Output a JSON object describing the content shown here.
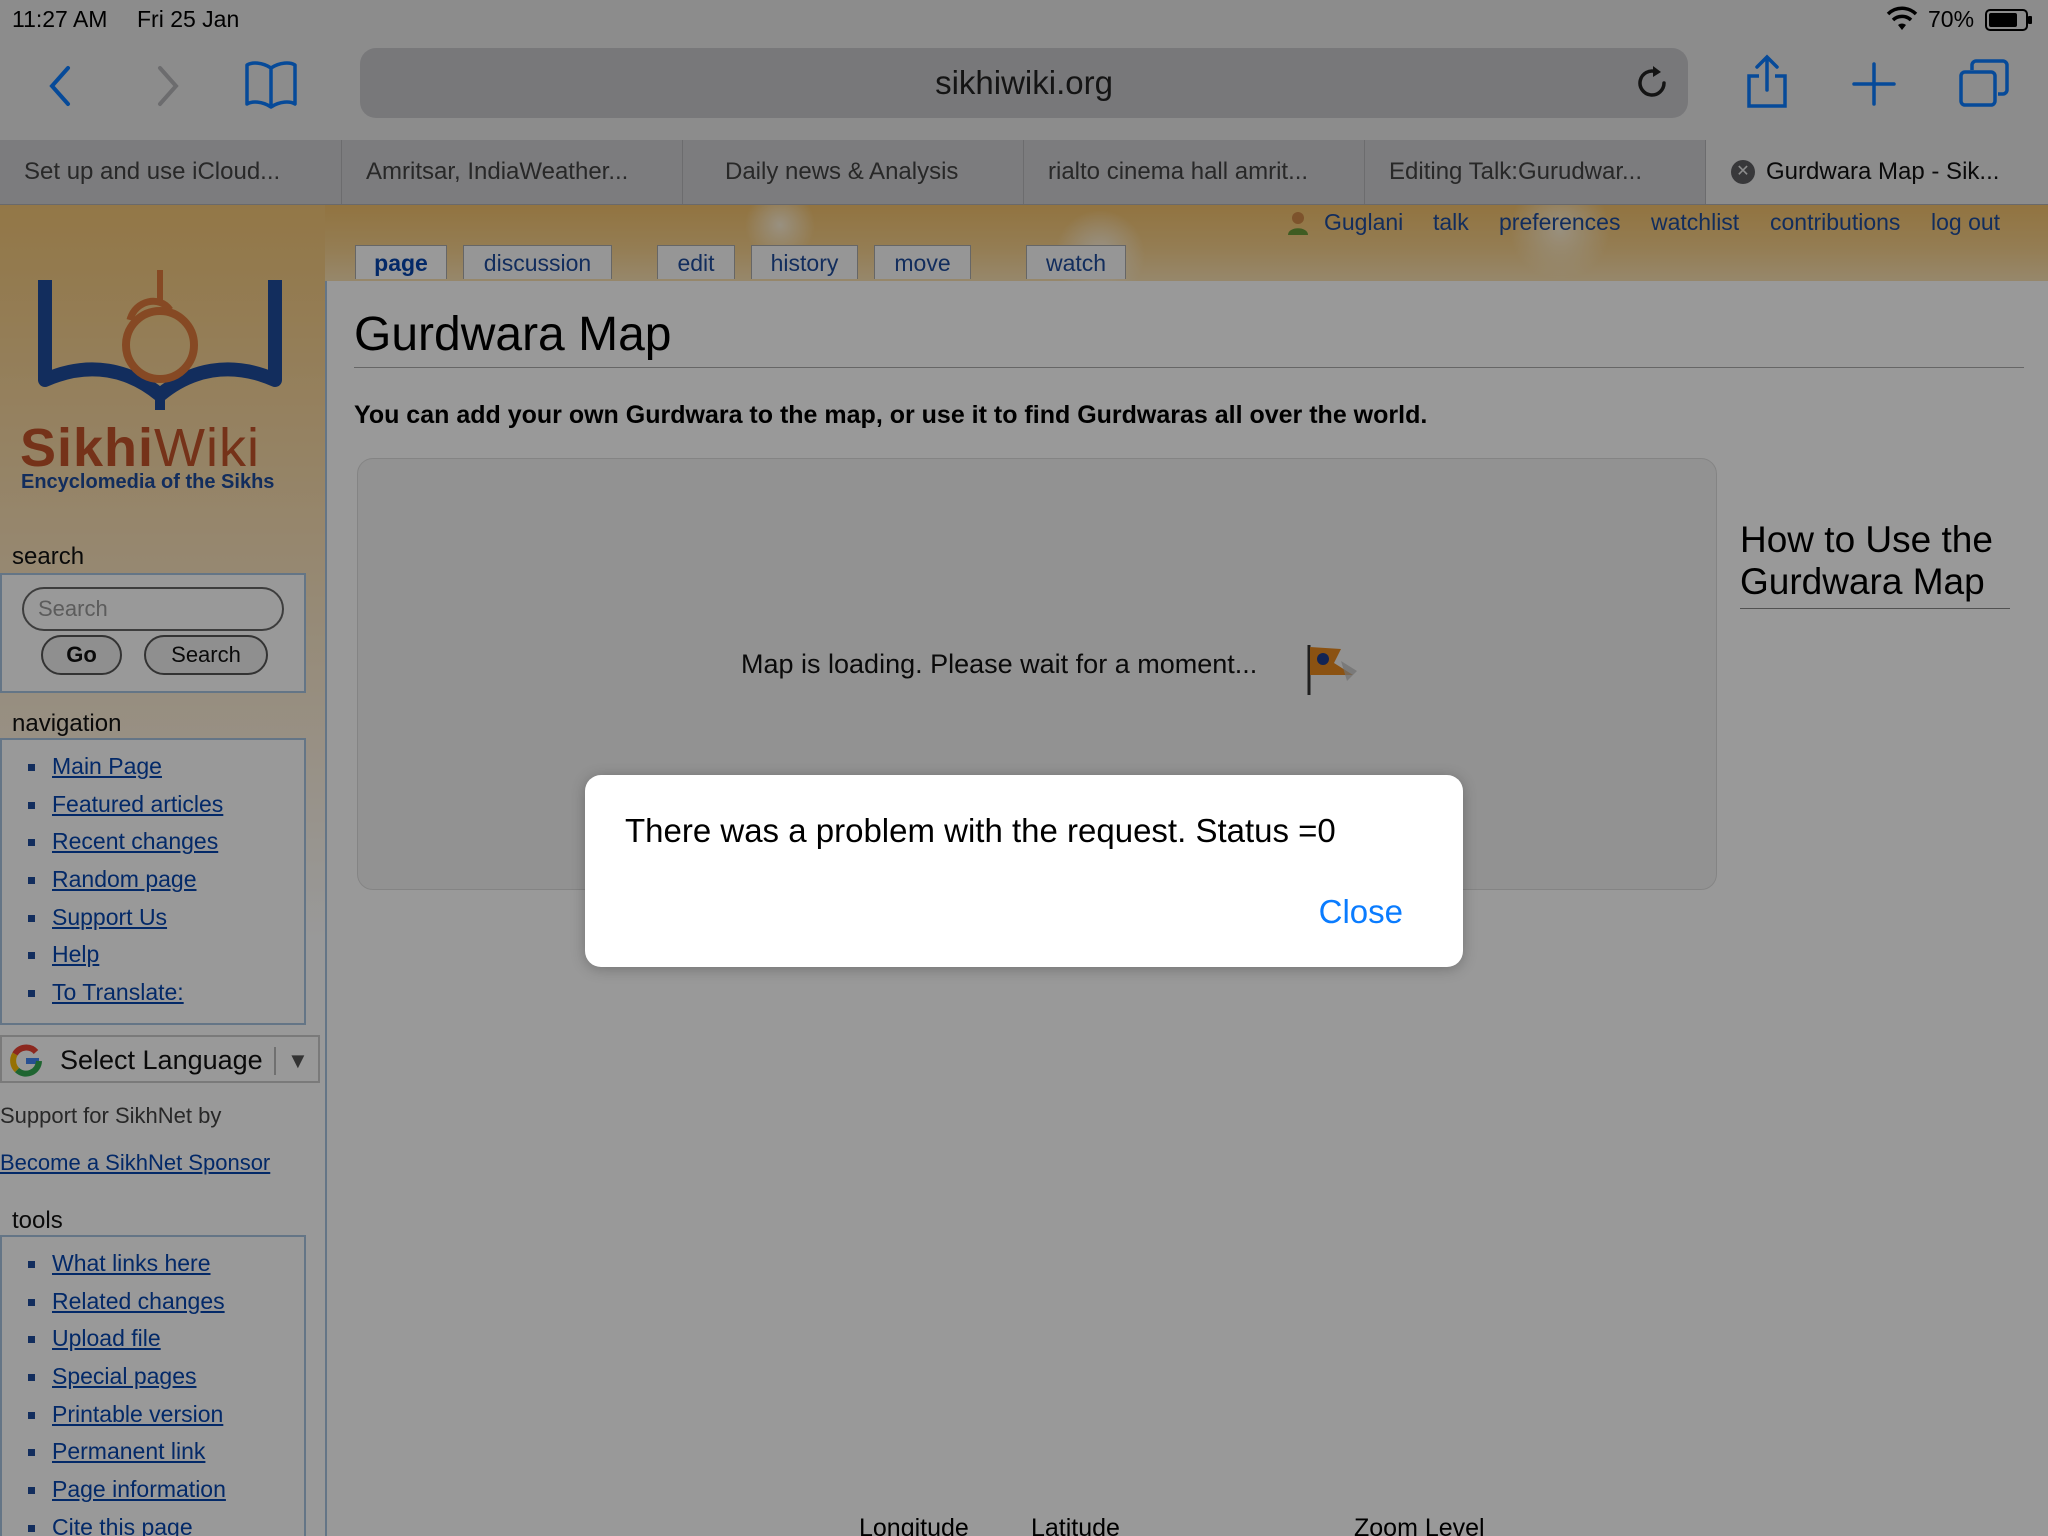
{
  "status_bar": {
    "time": "11:27 AM",
    "date": "Fri 25 Jan",
    "battery": "70%"
  },
  "browser": {
    "url": "sikhiwiki.org",
    "tabs": [
      {
        "label": "Set up and use iCloud..."
      },
      {
        "label": "Amritsar, IndiaWeather..."
      },
      {
        "label": "Daily news & Analysis"
      },
      {
        "label": "rialto cinema hall amrit..."
      },
      {
        "label": "Editing Talk:Gurudwar..."
      },
      {
        "label": "Gurdwara Map - Sik..."
      }
    ]
  },
  "site": {
    "logo_sikhi": "Sikhi",
    "logo_wiki": "Wiki",
    "logo_sub": "Encyclomedia of the Sikhs",
    "user_links": [
      "Guglani",
      "talk",
      "preferences",
      "watchlist",
      "contributions",
      "log out"
    ],
    "page_tabs": [
      "page",
      "discussion",
      "edit",
      "history",
      "move",
      "watch"
    ]
  },
  "sidebar": {
    "search_heading": "search",
    "search_placeholder": "Search",
    "go_label": "Go",
    "search_label": "Search",
    "navigation_heading": "navigation",
    "navigation": [
      "Main Page",
      "Featured articles",
      "Recent changes",
      "Random page",
      "Support Us",
      "Help",
      "To Translate:"
    ],
    "language_label": "Select Language",
    "support_text": "Support for SikhNet by",
    "sponsor_link": "Become a SikhNet Sponsor",
    "tools_heading": "tools",
    "tools": [
      "What links here",
      "Related changes",
      "Upload file",
      "Special pages",
      "Printable version",
      "Permanent link",
      "Page information",
      "Cite this page"
    ]
  },
  "content": {
    "title": "Gurdwara Map",
    "intro": "You can add your own Gurdwara to the map, or use it to find Gurdwaras all over the world.",
    "map_loading": "Map is loading. Please wait for a moment...",
    "howto_line1": "How to Use the",
    "howto_line2": "Gurdwara Map",
    "columns": [
      "Longitude",
      "Latitude",
      "Zoom Level"
    ]
  },
  "dialog": {
    "message": "There was a problem with the request. Status =0",
    "close_label": "Close"
  },
  "colors": {
    "accent": "#0a7cff",
    "link": "#0645ad",
    "header_orange": "#f3c16c",
    "logo_red": "#c4542b",
    "logo_blue": "#1f4c9c"
  }
}
